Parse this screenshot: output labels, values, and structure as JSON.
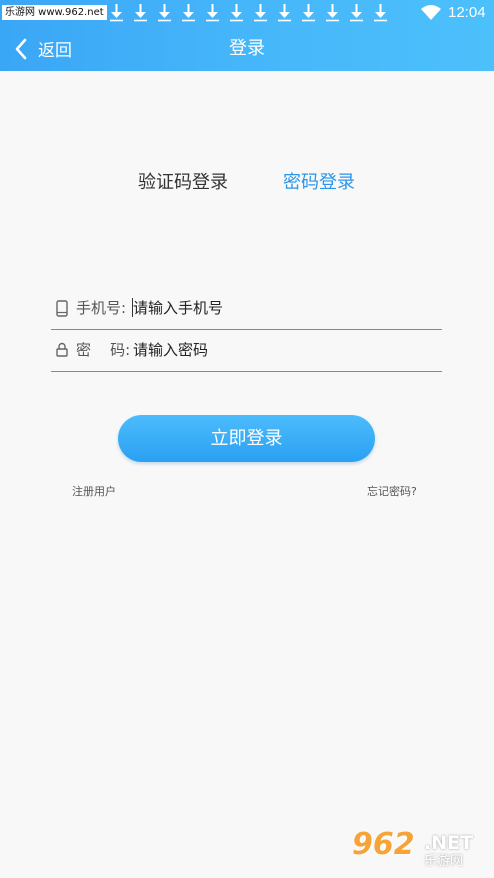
{
  "status_bar": {
    "watermark": "乐游网 www.962.net",
    "download_icon_count": 12,
    "icons": [
      "download-icon",
      "wifi-icon"
    ],
    "time": "12:04"
  },
  "header": {
    "back_label": "返回",
    "back_icon": "chevron-left-icon",
    "title": "登录"
  },
  "tabs": {
    "code_login": "验证码登录",
    "password_login": "密码登录",
    "active": "password_login"
  },
  "form": {
    "phone": {
      "icon": "phone-icon",
      "label": "手机号:",
      "value": "",
      "placeholder": "请输入手机号"
    },
    "password": {
      "icon": "lock-icon",
      "label": "密    码:",
      "value": "",
      "placeholder": "请输入密码"
    }
  },
  "actions": {
    "login_label": "立即登录",
    "register_label": "注册用户",
    "forgot_label": "忘记密码?"
  },
  "watermark_bottom": {
    "number": "962",
    "suffix": ".NET",
    "cn": "乐游网"
  },
  "colors": {
    "header_start": "#3aa6f6",
    "header_end": "#4cc0fb",
    "accent": "#2a95ea",
    "background": "#f8f8f8",
    "watermark_orange": "#f6a43a"
  }
}
